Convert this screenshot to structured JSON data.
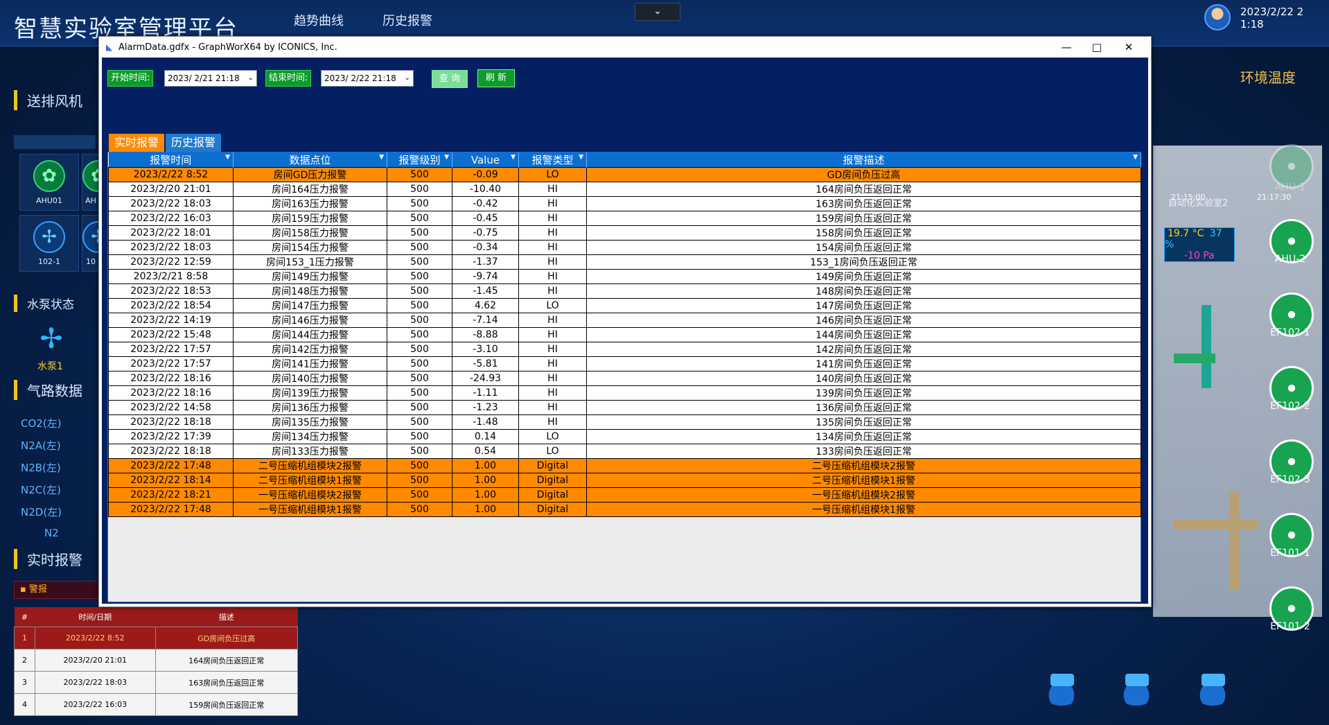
{
  "app": {
    "title": "智慧实验室管理平台",
    "nav": [
      "趋势曲线",
      "历史报警"
    ],
    "collapse_icon": "chevron-down-icon",
    "clock": "2023/2/22 2 1:18"
  },
  "left": {
    "section_fan": "送排风机",
    "fan_tiles": [
      "AHU01",
      "AH",
      "102-1",
      "10"
    ],
    "section_pump": "水泵状态",
    "pump_label": "水泵1",
    "section_gas": "气路数据",
    "gas": [
      "CO2(左)",
      "N2A(左)",
      "N2B(左)",
      "N2C(左)",
      "N2D(左)",
      "N2"
    ],
    "section_alarm": "实时报警",
    "warn_label": "警报",
    "mini_headers": [
      "#",
      "时间/日期",
      "描述"
    ],
    "mini_rows": [
      [
        "1",
        "2023/2/22 8:52",
        "GD房间负压过高"
      ],
      [
        "2",
        "2023/2/20 21:01",
        "164房间负压返回正常"
      ],
      [
        "3",
        "2023/2/22 18:03",
        "163房间负压返回正常"
      ],
      [
        "4",
        "2023/2/22 16:03",
        "159房间负压返回正常"
      ]
    ]
  },
  "right": {
    "title": "环境温度",
    "room_label": "自动化实验室2",
    "times": [
      "21:15:00",
      "21:17:30"
    ],
    "temp": "19.7 °C",
    "humidity": "37 %",
    "pressure": "-10 Pa",
    "fans": [
      "AHU-1",
      "AHU-2",
      "EF102-1",
      "EF102-2",
      "EF102-3",
      "EF101-1",
      "EF101-2"
    ]
  },
  "window": {
    "title": "AlarmData.gdfx - GraphWorX64 by ICONICS, Inc.",
    "start_label": "开始时间:",
    "start_value": "2023/ 2/21 21:18",
    "end_label": "结束时间:",
    "end_value": "2023/ 2/22 21:18",
    "query_btn": "查 询",
    "refresh_btn": "刷 新",
    "tab_realtime": "实时报警",
    "tab_history": "历史报警",
    "columns": [
      "报警时间",
      "数据点位",
      "报警级别",
      "Value",
      "报警类型",
      "报警描述"
    ],
    "rows": [
      {
        "time": "2023/2/22 8:52",
        "point": "房间GD压力报警",
        "level": "500",
        "value": "-0.09",
        "type": "LO",
        "desc": "GD房间负压过高",
        "hl": true
      },
      {
        "time": "2023/2/20 21:01",
        "point": "房间164压力报警",
        "level": "500",
        "value": "-10.40",
        "type": "HI",
        "desc": "164房间负压返回正常",
        "hl": false
      },
      {
        "time": "2023/2/22 18:03",
        "point": "房间163压力报警",
        "level": "500",
        "value": "-0.42",
        "type": "HI",
        "desc": "163房间负压返回正常",
        "hl": false
      },
      {
        "time": "2023/2/22 16:03",
        "point": "房间159压力报警",
        "level": "500",
        "value": "-0.45",
        "type": "HI",
        "desc": "159房间负压返回正常",
        "hl": false
      },
      {
        "time": "2023/2/22 18:01",
        "point": "房间158压力报警",
        "level": "500",
        "value": "-0.75",
        "type": "HI",
        "desc": "158房间负压返回正常",
        "hl": false
      },
      {
        "time": "2023/2/22 18:03",
        "point": "房间154压力报警",
        "level": "500",
        "value": "-0.34",
        "type": "HI",
        "desc": "154房间负压返回正常",
        "hl": false
      },
      {
        "time": "2023/2/22 12:59",
        "point": "房间153_1压力报警",
        "level": "500",
        "value": "-1.37",
        "type": "HI",
        "desc": "153_1房间负压返回正常",
        "hl": false
      },
      {
        "time": "2023/2/21 8:58",
        "point": "房间149压力报警",
        "level": "500",
        "value": "-9.74",
        "type": "HI",
        "desc": "149房间负压返回正常",
        "hl": false
      },
      {
        "time": "2023/2/22 18:53",
        "point": "房间148压力报警",
        "level": "500",
        "value": "-1.45",
        "type": "HI",
        "desc": "148房间负压返回正常",
        "hl": false
      },
      {
        "time": "2023/2/22 18:54",
        "point": "房间147压力报警",
        "level": "500",
        "value": "4.62",
        "type": "LO",
        "desc": "147房间负压返回正常",
        "hl": false
      },
      {
        "time": "2023/2/22 14:19",
        "point": "房间146压力报警",
        "level": "500",
        "value": "-7.14",
        "type": "HI",
        "desc": "146房间负压返回正常",
        "hl": false
      },
      {
        "time": "2023/2/22 15:48",
        "point": "房间144压力报警",
        "level": "500",
        "value": "-8.88",
        "type": "HI",
        "desc": "144房间负压返回正常",
        "hl": false
      },
      {
        "time": "2023/2/22 17:57",
        "point": "房间142压力报警",
        "level": "500",
        "value": "-3.10",
        "type": "HI",
        "desc": "142房间负压返回正常",
        "hl": false
      },
      {
        "time": "2023/2/22 17:57",
        "point": "房间141压力报警",
        "level": "500",
        "value": "-5.81",
        "type": "HI",
        "desc": "141房间负压返回正常",
        "hl": false
      },
      {
        "time": "2023/2/22 18:16",
        "point": "房间140压力报警",
        "level": "500",
        "value": "-24.93",
        "type": "HI",
        "desc": "140房间负压返回正常",
        "hl": false
      },
      {
        "time": "2023/2/22 18:16",
        "point": "房间139压力报警",
        "level": "500",
        "value": "-1.11",
        "type": "HI",
        "desc": "139房间负压返回正常",
        "hl": false
      },
      {
        "time": "2023/2/22 14:58",
        "point": "房间136压力报警",
        "level": "500",
        "value": "-1.23",
        "type": "HI",
        "desc": "136房间负压返回正常",
        "hl": false
      },
      {
        "time": "2023/2/22 18:18",
        "point": "房间135压力报警",
        "level": "500",
        "value": "-1.48",
        "type": "HI",
        "desc": "135房间负压返回正常",
        "hl": false
      },
      {
        "time": "2023/2/22 17:39",
        "point": "房间134压力报警",
        "level": "500",
        "value": "0.14",
        "type": "LO",
        "desc": "134房间负压返回正常",
        "hl": false
      },
      {
        "time": "2023/2/22 18:18",
        "point": "房间133压力报警",
        "level": "500",
        "value": "0.54",
        "type": "LO",
        "desc": "133房间负压返回正常",
        "hl": false
      },
      {
        "time": "2023/2/22 17:48",
        "point": "二号压缩机组模块2报警",
        "level": "500",
        "value": "1.00",
        "type": "Digital",
        "desc": "二号压缩机组模块2报警",
        "hl": true
      },
      {
        "time": "2023/2/22 18:14",
        "point": "二号压缩机组模块1报警",
        "level": "500",
        "value": "1.00",
        "type": "Digital",
        "desc": "二号压缩机组模块1报警",
        "hl": true
      },
      {
        "time": "2023/2/22 18:21",
        "point": "一号压缩机组模块2报警",
        "level": "500",
        "value": "1.00",
        "type": "Digital",
        "desc": "一号压缩机组模块2报警",
        "hl": true
      },
      {
        "time": "2023/2/22 17:48",
        "point": "一号压缩机组模块1报警",
        "level": "500",
        "value": "1.00",
        "type": "Digital",
        "desc": "一号压缩机组模块1报警",
        "hl": true
      }
    ]
  }
}
